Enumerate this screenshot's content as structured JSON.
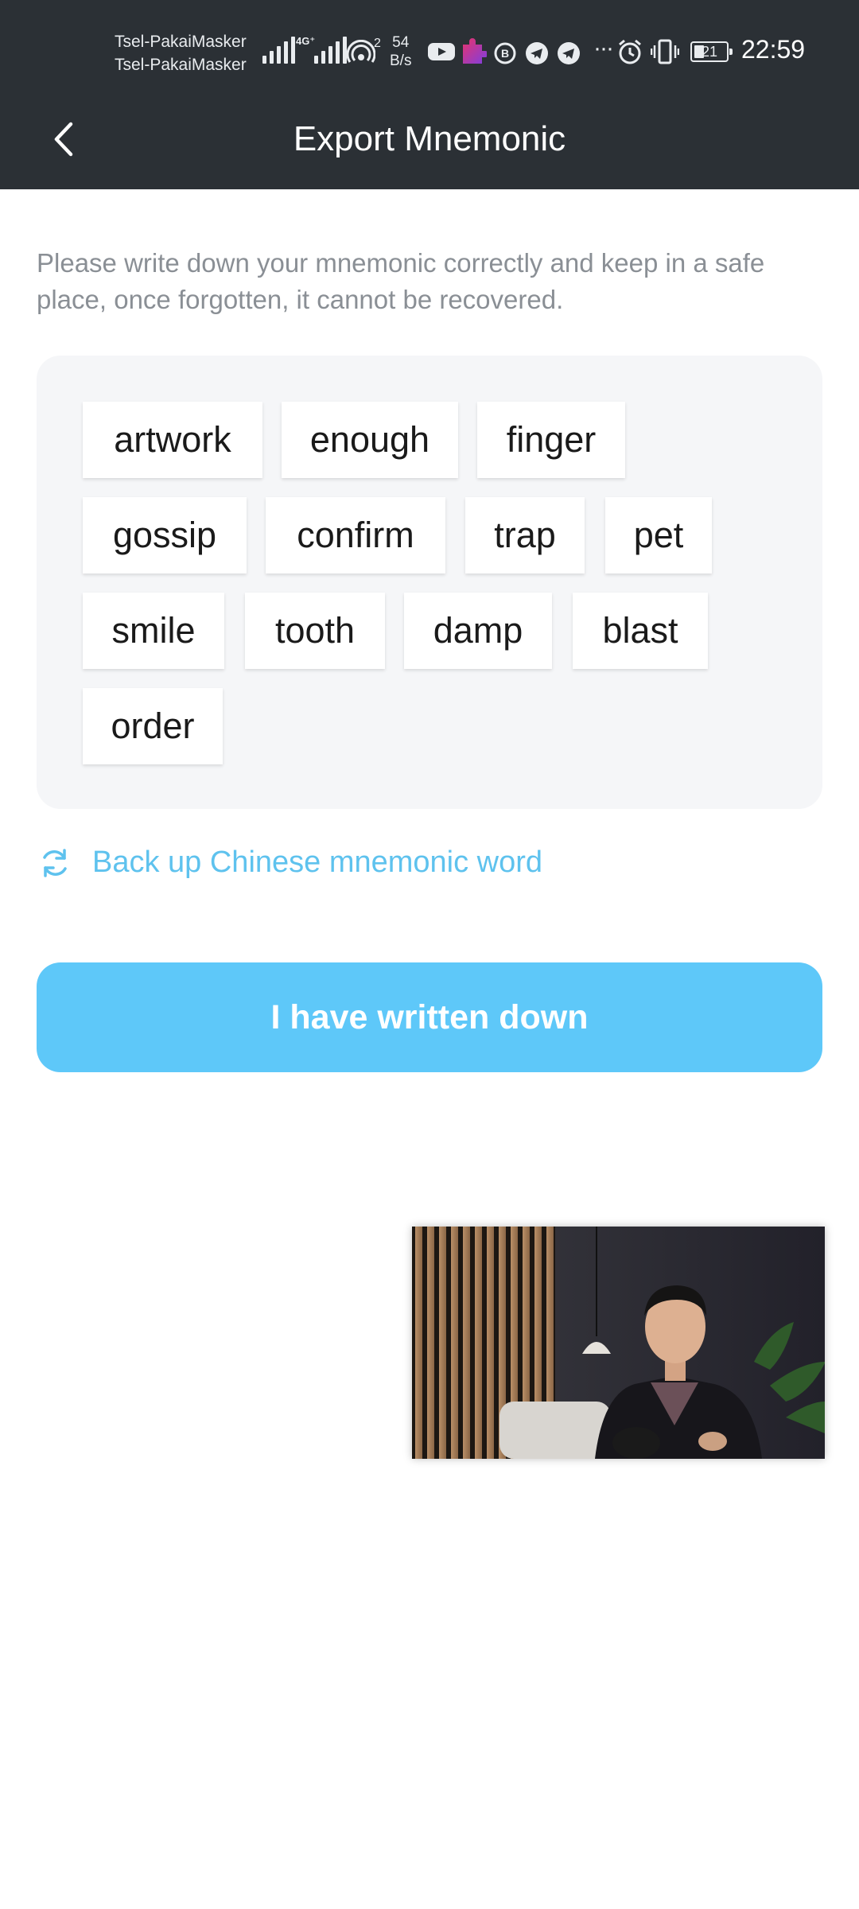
{
  "status_bar": {
    "carriers": [
      "Tsel-PakaiMasker",
      "Tsel-PakaiMasker"
    ],
    "network_label": "4G⁺",
    "hotspot_sub": "2",
    "speed_value": "54",
    "speed_unit": "B/s",
    "battery": "21",
    "time": "22:59",
    "icons": [
      "signal-icon",
      "signal-4g-icon",
      "hotspot-icon",
      "youtube-icon",
      "puzzle-app-icon",
      "b-app-icon",
      "telegram-icon",
      "telegram-icon",
      "more-dots-icon",
      "alarm-icon",
      "vibrate-icon",
      "battery-icon"
    ]
  },
  "header": {
    "title": "Export Mnemonic",
    "back_icon": "chevron-left-icon"
  },
  "instructions": "Please write down your mnemonic correctly and keep in a safe place, once forgotten, it cannot be recovered.",
  "mnemonic": {
    "words": [
      "artwork",
      "enough",
      "finger",
      "gossip",
      "confirm",
      "trap",
      "pet",
      "smile",
      "tooth",
      "damp",
      "blast",
      "order"
    ]
  },
  "chinese_backup": {
    "label": "Back up Chinese mnemonic word",
    "icon": "refresh-icon"
  },
  "confirm_button": {
    "label": "I have written down"
  },
  "colors": {
    "header_bg": "#2b3035",
    "accent": "#5ec8f9",
    "link": "#5ec2ee",
    "panel_bg": "#f5f6f8"
  }
}
